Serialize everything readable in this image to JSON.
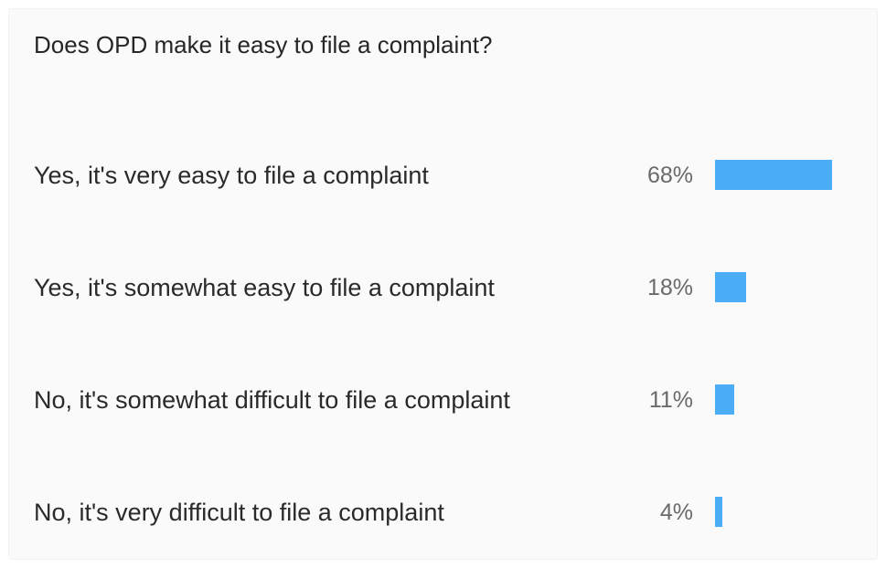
{
  "poll": {
    "question": "Does OPD make it easy to file a complaint?"
  },
  "colors": {
    "bar": "#4aadf6",
    "background": "#fafafa"
  },
  "chart_data": {
    "type": "bar",
    "orientation": "horizontal",
    "title": "Does OPD make it easy to file a complaint?",
    "categories": [
      "Yes, it's very easy to file a complaint",
      "Yes, it's somewhat easy to file a complaint",
      "No, it's somewhat difficult to file a complaint",
      "No, it's very difficult to file a complaint"
    ],
    "values": [
      68,
      18,
      11,
      4
    ],
    "value_labels": [
      "68%",
      "18%",
      "11%",
      "4%"
    ],
    "unit": "%"
  }
}
